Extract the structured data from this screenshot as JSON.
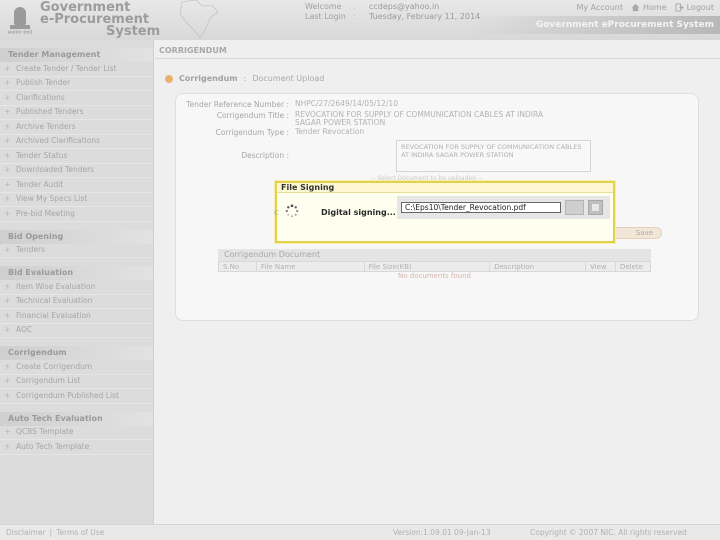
{
  "header": {
    "brand_line1": "Government",
    "brand_line2": "e-Procurement",
    "brand_line3": "System",
    "welcome_label": "Welcome",
    "welcome_value": "ccdeps@yahoo.in",
    "last_login_label": "Last Login",
    "last_login_value": "Tuesday, February 11, 2014",
    "links": {
      "my_account": "My Account",
      "home": "Home",
      "logout": "Logout"
    },
    "system_title": "Government eProcurement System"
  },
  "sidebar": {
    "sections": [
      {
        "heading": "Tender Management",
        "items": [
          "Create Tender / Tender List",
          "Publish Tender",
          "Clarifications",
          "Published Tenders",
          "Archive Tenders",
          "Archived Clarifications",
          "Tender Status",
          "Downloaded Tenders",
          "Tender Audit",
          "View My Specs List",
          "Pre-bid Meeting"
        ]
      },
      {
        "heading": "Bid Opening",
        "items": [
          "Tenders"
        ]
      },
      {
        "heading": "Bid Evaluation",
        "items": [
          "Item Wise Evaluation",
          "Technical Evaluation",
          "Financial Evaluation",
          "AOC"
        ]
      },
      {
        "heading": "Corrigendum",
        "items": [
          "Create Corrigendum",
          "Corrigendum List",
          "Corrigendum Published List"
        ]
      },
      {
        "heading": "Auto Tech Evaluation",
        "items": [
          "QCBS Template",
          "Auto Tech Template"
        ]
      }
    ]
  },
  "main": {
    "page_title": "CORRIGENDUM",
    "breadcrumb": {
      "item1": "Corrigendum",
      "separator": ":",
      "item2": "Document Upload"
    },
    "fields": {
      "tender_ref_label": "Tender Reference Number :",
      "tender_ref_value": "NHPC/27/2649/14/05/12/10",
      "corr_title_label": "Corrigendum Title :",
      "corr_title_value": "REVOCATION FOR SUPPLY OF COMMUNICATION CABLES AT INDIRA SAGAR POWER STATION",
      "corr_type_label": "Corrigendum Type :",
      "corr_type_value": "Tender Revocation",
      "description_label": "Description :",
      "description_value": "REVOCATION FOR SUPPLY OF COMMUNICATION CABLES AT INDIRA SAGAR POWER STATION"
    },
    "dashed_note": "-- Select Document to be uploaded --",
    "save_label": "Save",
    "documents": {
      "heading": "Corrigendum Document",
      "columns": [
        "S.No",
        "File Name",
        "File Size(KB)",
        "Description",
        "View",
        "Delete"
      ],
      "empty_message": "No documents found"
    }
  },
  "dialog": {
    "title": "File Signing",
    "status": "Digital signing... P",
    "file_path": "C:\\Eps10\\Tender_Revocation.pdf",
    "left_char": "C"
  },
  "footer": {
    "disclaimer": "Disclaimer",
    "separator": "|",
    "terms": "Terms of Use",
    "version": "Version:1.09.01 09-Jan-13",
    "copyright": "Copyright © 2007 NIC. All rights reserved"
  }
}
